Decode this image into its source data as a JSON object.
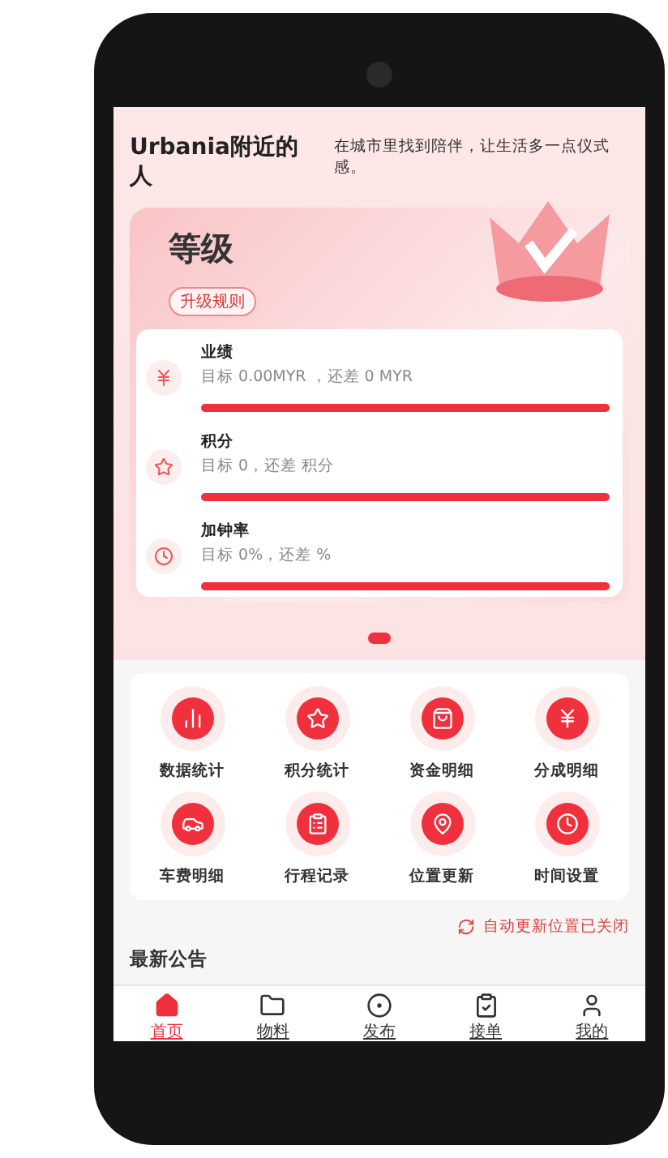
{
  "header": {
    "title": "Urbania附近的人",
    "subtitle": "在城市里找到陪伴，让生活多一点仪式感。"
  },
  "level_card": {
    "title": "等级",
    "rules_button": "升级规则",
    "metrics": [
      {
        "kind": "money",
        "name": "业绩",
        "detail": "目标 0.00MYR ，还差 0 MYR",
        "level": 1
      },
      {
        "kind": "star",
        "name": "积分",
        "detail": "目标 0，还差 积分",
        "level": 1
      },
      {
        "kind": "clock",
        "name": "加钟率",
        "detail": "目标 0%，还差 %",
        "level": 1
      }
    ]
  },
  "shortcuts": [
    {
      "kind": "chart",
      "label": "数据统计"
    },
    {
      "kind": "star",
      "label": "积分统计"
    },
    {
      "kind": "bag",
      "label": "资金明细"
    },
    {
      "kind": "yen",
      "label": "分成明细"
    },
    {
      "kind": "car",
      "label": "车费明细"
    },
    {
      "kind": "clipboard",
      "label": "行程记录"
    },
    {
      "kind": "pin",
      "label": "位置更新"
    },
    {
      "kind": "clock",
      "label": "时间设置"
    }
  ],
  "location_status": "自动更新位置已关闭",
  "announcements": {
    "title": "最新公告"
  },
  "tab_bar": [
    {
      "kind": "home",
      "label": "首页",
      "selected": true
    },
    {
      "kind": "folder",
      "label": "物料",
      "selected": false
    },
    {
      "kind": "publish",
      "label": "发布",
      "selected": false
    },
    {
      "kind": "order",
      "label": "接单",
      "selected": false
    },
    {
      "kind": "user",
      "label": "我的",
      "selected": false
    }
  ]
}
